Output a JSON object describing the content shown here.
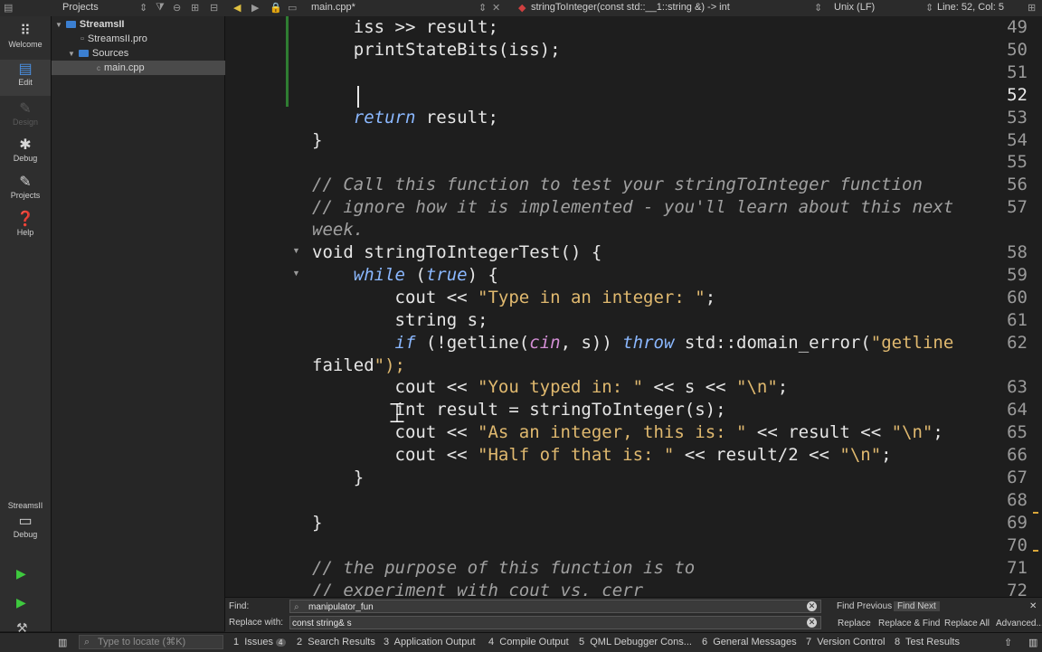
{
  "topbar": {
    "projects_label": "Projects",
    "file_tab": "main.cpp*",
    "function_combo": "stringToInteger(const std::__1::string &) -> int",
    "line_ending": "Unix (LF)",
    "position": "Line: 52, Col: 5"
  },
  "modes": [
    {
      "label": "Welcome",
      "icon": "grid-icon"
    },
    {
      "label": "Edit",
      "icon": "edit-icon"
    },
    {
      "label": "Design",
      "icon": "pen-icon"
    },
    {
      "label": "Debug",
      "icon": "bug-icon"
    },
    {
      "label": "Projects",
      "icon": "wrench-icon"
    },
    {
      "label": "Help",
      "icon": "help-icon"
    }
  ],
  "kit": {
    "name": "StreamsII",
    "build": "Debug"
  },
  "project_tree": [
    {
      "label": "StreamsII",
      "level": 0
    },
    {
      "label": "StreamsII.pro",
      "level": 1
    },
    {
      "label": "Sources",
      "level": 1
    },
    {
      "label": "main.cpp",
      "level": 2
    }
  ],
  "editor": {
    "current_line": "52",
    "lines": [
      {
        "n": "49",
        "text": "    iss >> result;"
      },
      {
        "n": "50",
        "text": "    printStateBits(iss);"
      },
      {
        "n": "51",
        "text": ""
      },
      {
        "n": "52",
        "text": ""
      },
      {
        "n": "53",
        "text": "    return result;"
      },
      {
        "n": "54",
        "text": "}"
      },
      {
        "n": "55",
        "text": ""
      },
      {
        "n": "56",
        "text": "// Call this function to test your stringToInteger function"
      },
      {
        "n": "57",
        "text": "// ignore how it is implemented - you'll learn about this next"
      },
      {
        "n": "",
        "text": "week."
      },
      {
        "n": "58",
        "text": "void stringToIntegerTest() {"
      },
      {
        "n": "59",
        "text": "    while (true) {"
      },
      {
        "n": "60",
        "text": "        cout << \"Type in an integer: \";"
      },
      {
        "n": "61",
        "text": "        string s;"
      },
      {
        "n": "62",
        "text": "        if (!getline(cin, s)) throw std::domain_error(\"getline"
      },
      {
        "n": "",
        "text": "failed\");"
      },
      {
        "n": "63",
        "text": "        cout << \"You typed in: \" << s << \"\\n\";"
      },
      {
        "n": "64",
        "text": "        int result = stringToInteger(s);"
      },
      {
        "n": "65",
        "text": "        cout << \"As an integer, this is: \" << result << \"\\n\";"
      },
      {
        "n": "66",
        "text": "        cout << \"Half of that is: \" << result/2 << \"\\n\";"
      },
      {
        "n": "67",
        "text": "    }"
      },
      {
        "n": "68",
        "text": ""
      },
      {
        "n": "69",
        "text": "}"
      },
      {
        "n": "70",
        "text": ""
      },
      {
        "n": "71",
        "text": "// the purpose of this function is to"
      },
      {
        "n": "72",
        "text": "// experiment with cout vs. cerr"
      }
    ]
  },
  "find": {
    "find_label": "Find:",
    "find_value": "manipulator_fun",
    "replace_label": "Replace with:",
    "replace_value": "const string& s",
    "find_previous": "Find Previous",
    "find_next": "Find Next",
    "replace": "Replace",
    "replace_find": "Replace & Find",
    "replace_all": "Replace All",
    "advanced": "Advanced..."
  },
  "status": {
    "locate_placeholder": "Type to locate (⌘K)",
    "tabs": [
      {
        "num": "1",
        "label": "Issues",
        "badge": "4"
      },
      {
        "num": "2",
        "label": "Search Results"
      },
      {
        "num": "3",
        "label": "Application Output"
      },
      {
        "num": "4",
        "label": "Compile Output"
      },
      {
        "num": "5",
        "label": "QML Debugger Cons..."
      },
      {
        "num": "6",
        "label": "General Messages"
      },
      {
        "num": "7",
        "label": "Version Control"
      },
      {
        "num": "8",
        "label": "Test Results"
      }
    ]
  },
  "colors": {
    "keyword_italic": "#8bb8ff",
    "string": "#e0b96f",
    "comment": "#a0a0a0",
    "variable": "#d48fd6",
    "folder": "#3b7fd1",
    "run_green": "#3ec93e"
  }
}
